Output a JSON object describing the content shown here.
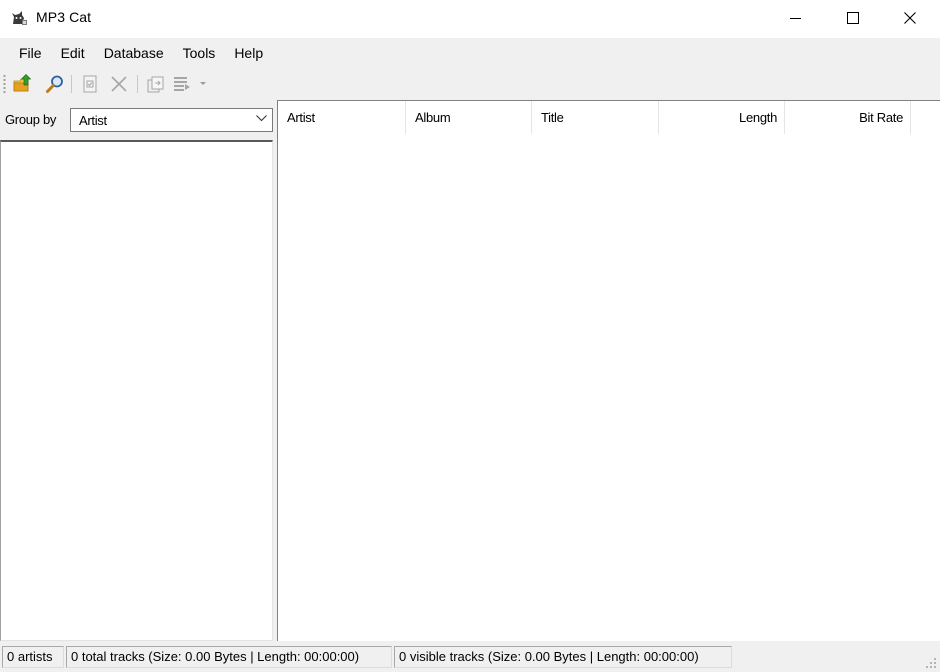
{
  "window": {
    "title": "MP3 Cat",
    "icon": "mp3cat-app-icon",
    "controls": [
      "minimize",
      "maximize",
      "close"
    ]
  },
  "menu": {
    "items": [
      {
        "label": "File"
      },
      {
        "label": "Edit"
      },
      {
        "label": "Database"
      },
      {
        "label": "Tools"
      },
      {
        "label": "Help"
      }
    ]
  },
  "toolbar": {
    "buttons": [
      {
        "icon": "add-folder-icon",
        "enabled": true
      },
      {
        "icon": "search-icon",
        "enabled": true
      },
      {
        "icon": "properties-icon",
        "enabled": false
      },
      {
        "icon": "delete-icon",
        "enabled": false
      },
      {
        "icon": "export-icon",
        "enabled": false
      },
      {
        "icon": "report-icon",
        "enabled": false
      }
    ]
  },
  "left_panel": {
    "group_by_label": "Group by",
    "group_by_value": "Artist"
  },
  "list": {
    "columns": [
      {
        "label": "Artist"
      },
      {
        "label": "Album"
      },
      {
        "label": "Title"
      },
      {
        "label": "Length"
      },
      {
        "label": "Bit Rate"
      }
    ],
    "rows": []
  },
  "status": {
    "artists": "0 artists",
    "total_tracks": "0 total tracks (Size: 0.00 Bytes | Length: 00:00:00)",
    "visible_tracks": "0 visible tracks (Size: 0.00 Bytes | Length: 00:00:00)"
  },
  "colors": {
    "chrome": "#f0f0f0",
    "content": "#ffffff",
    "border": "#828282",
    "accent_green": "#3a9b2a",
    "accent_orange": "#e8a020"
  }
}
